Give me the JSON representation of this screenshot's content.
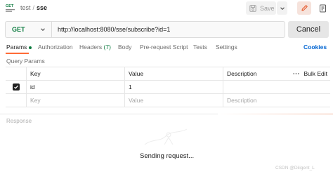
{
  "breadcrumb": {
    "parent": "test",
    "separator": "/",
    "current": "sse"
  },
  "toolbar": {
    "save_label": "Save"
  },
  "request": {
    "method": "GET",
    "url": "http://localhost:8080/sse/subscribe?id=1",
    "cancel_label": "Cancel"
  },
  "tabs": {
    "params": "Params",
    "authorization": "Authorization",
    "headers": "Headers",
    "headers_count": "(7)",
    "body": "Body",
    "prerequest": "Pre-request Script",
    "tests": "Tests",
    "settings": "Settings",
    "cookies": "Cookies"
  },
  "query_params": {
    "label": "Query Params",
    "columns": {
      "key": "Key",
      "value": "Value",
      "description": "Description",
      "bulk_edit": "Bulk Edit"
    },
    "rows": [
      {
        "key": "id",
        "value": "1",
        "checked": true
      }
    ],
    "placeholders": {
      "key": "Key",
      "value": "Value",
      "description": "Description"
    }
  },
  "response": {
    "label": "Response",
    "status_text": "Sending request..."
  },
  "watermark": "CSDN @Diligent_L",
  "colors": {
    "accent": "#ff6c37",
    "method_get": "#0b7a3e",
    "link": "#0265d2"
  },
  "icons": [
    "http-request-icon",
    "save-icon",
    "chevron-down-icon",
    "edit-icon",
    "document-icon",
    "check-icon",
    "more-icon"
  ]
}
